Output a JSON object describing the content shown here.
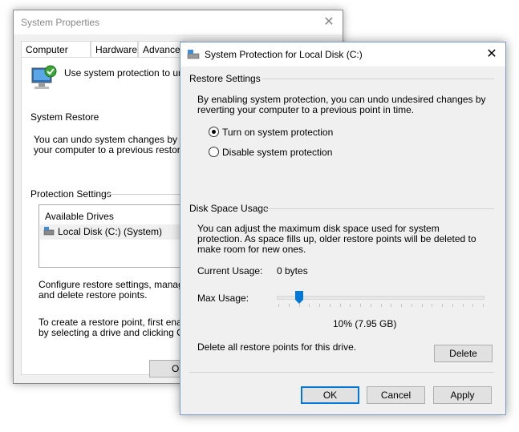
{
  "back_window": {
    "title": "System Properties",
    "tabs": [
      "Computer Name",
      "Hardware",
      "Advanced"
    ],
    "intro_text": "Use system protection to undo",
    "system_restore_heading": "System Restore",
    "system_restore_text_1": "You can undo system changes by reve",
    "system_restore_text_2": "your computer to a previous restore poi",
    "protection_heading": "Protection Settings",
    "drives_header": "Available Drives",
    "drive_item": "Local Disk (C:) (System)",
    "configure_text_1": "Configure restore settings, manage dis",
    "configure_text_2": "and delete restore points.",
    "create_text_1": "To create a restore point, first enable",
    "create_text_2": "by selecting a drive and clicking Confi",
    "ok_label": "OK"
  },
  "dialog": {
    "title": "System Protection for Local Disk (C:)",
    "restore_settings_heading": "Restore Settings",
    "restore_settings_desc": "By enabling system protection, you can undo undesired changes by reverting your computer to a previous point in time.",
    "radio_on": "Turn on system protection",
    "radio_off": "Disable system protection",
    "selected_option": "Turn on system protection",
    "disk_usage_heading": "Disk Space Usage",
    "disk_usage_desc": "You can adjust the maximum disk space used for system protection. As space fills up, older restore points will be deleted to make room for new ones.",
    "current_usage_label": "Current Usage:",
    "current_usage_value": "0 bytes",
    "max_usage_label": "Max Usage:",
    "max_usage_fraction": 0.1,
    "max_usage_value": "10% (7.95 GB)",
    "delete_text": "Delete all restore points for this drive.",
    "delete_label": "Delete",
    "ok_label": "OK",
    "cancel_label": "Cancel",
    "apply_label": "Apply"
  },
  "colors": {
    "accent": "#0078d7",
    "window_bg": "#f0f0f0"
  }
}
